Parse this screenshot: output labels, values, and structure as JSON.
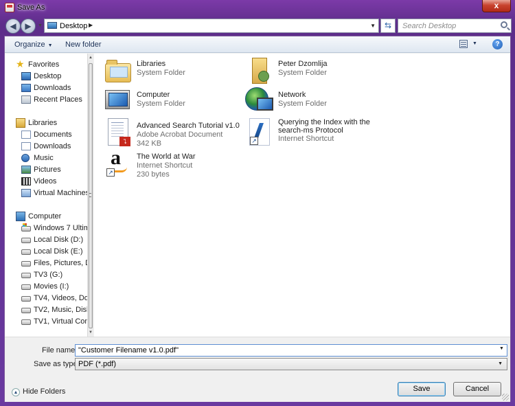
{
  "window": {
    "title": "Save As",
    "close_label": "x"
  },
  "address": {
    "location": "Desktop",
    "search_placeholder": "Search Desktop"
  },
  "toolbar": {
    "organize": "Organize",
    "new_folder": "New folder",
    "help": "?"
  },
  "nav": {
    "favorites": {
      "label": "Favorites",
      "items": [
        "Desktop",
        "Downloads",
        "Recent Places"
      ]
    },
    "libraries": {
      "label": "Libraries",
      "items": [
        "Documents",
        "Downloads",
        "Music",
        "Pictures",
        "Videos",
        "Virtual Machines"
      ]
    },
    "computer": {
      "label": "Computer",
      "items": [
        "Windows 7 Ultim",
        "Local Disk (D:)",
        "Local Disk (E:)",
        "Files, Pictures, De",
        "TV3 (G:)",
        "Movies (I:)",
        "TV4, Videos, Dow",
        "TV2, Music, Disk",
        "TV1, Virtual Com"
      ]
    }
  },
  "files": [
    {
      "name": "Libraries",
      "sub1": "System Folder"
    },
    {
      "name": "Peter Dzomlija",
      "sub1": "System Folder"
    },
    {
      "name": "Computer",
      "sub1": "System Folder"
    },
    {
      "name": "Network",
      "sub1": "System Folder"
    },
    {
      "name": "Advanced Search Tutorial v1.0",
      "sub1": "Adobe Acrobat Document",
      "sub2": "342 KB"
    },
    {
      "name": "Querying the Index with the",
      "name2": "search-ms Protocol",
      "sub1": "Internet Shortcut"
    },
    {
      "name": "The World at War",
      "sub1": "Internet Shortcut",
      "sub2": "230 bytes"
    }
  ],
  "form": {
    "file_name_label": "File name:",
    "file_name_value": "\"Customer Filename v1.0.pdf\"",
    "save_type_label": "Save as type:",
    "save_type_value": "PDF (*.pdf)"
  },
  "buttons": {
    "hide_folders": "Hide Folders",
    "save": "Save",
    "cancel": "Cancel"
  }
}
